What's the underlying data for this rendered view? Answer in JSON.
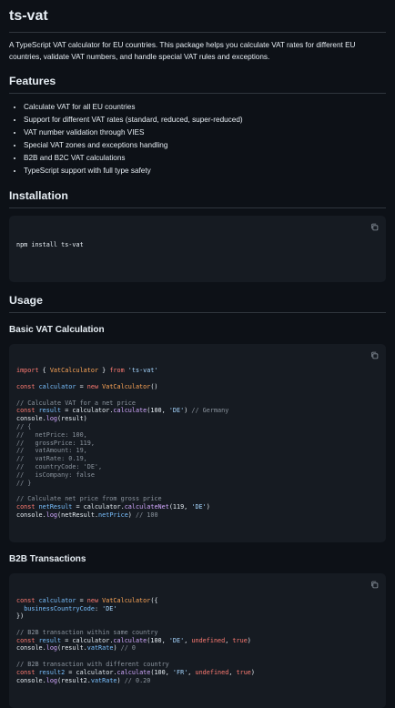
{
  "title": "ts-vat",
  "intro": "A TypeScript VAT calculator for EU countries. This package helps you calculate VAT rates for different EU countries, validate VAT numbers, and handle special VAT rules and exceptions.",
  "features": {
    "heading": "Features",
    "items": [
      "Calculate VAT for all EU countries",
      "Support for different VAT rates (standard, reduced, super-reduced)",
      "VAT number validation through VIES",
      "Special VAT zones and exceptions handling",
      "B2B and B2C VAT calculations",
      "TypeScript support with full type safety"
    ]
  },
  "installation": {
    "heading": "Installation",
    "command": "npm install ts-vat"
  },
  "usage": {
    "heading": "Usage",
    "basic": {
      "heading": "Basic VAT Calculation",
      "lines": [
        "import { VatCalculator } from 'ts-vat'",
        "",
        "const calculator = new VatCalculator()",
        "",
        "// Calculate VAT for a net price",
        "const result = calculator.calculate(100, 'DE') // Germany",
        "console.log(result)",
        "// {",
        "//   netPrice: 100,",
        "//   grossPrice: 119,",
        "//   vatAmount: 19,",
        "//   vatRate: 0.19,",
        "//   countryCode: 'DE',",
        "//   isCompany: false",
        "// }",
        "",
        "// Calculate net price from gross price",
        "const netResult = calculator.calculateNet(119, 'DE')",
        "console.log(netResult.netPrice) // 100"
      ]
    },
    "b2b": {
      "heading": "B2B Transactions",
      "lines": [
        "const calculator = new VatCalculator({",
        "  businessCountryCode: 'DE'",
        "})",
        "",
        "// B2B transaction within same country",
        "const result = calculator.calculate(100, 'DE', undefined, true)",
        "console.log(result.vatRate) // 0",
        "",
        "// B2B transaction with different country",
        "const result2 = calculator.calculate(100, 'FR', undefined, true)",
        "console.log(result2.vatRate) // 0.20"
      ]
    }
  },
  "icons": {
    "copy": "copy-icon"
  },
  "colors": {
    "background": "#0d1117",
    "code_background": "#161b22",
    "keyword": "#ff7b72",
    "comment": "#8b949e",
    "string": "#a5d6ff",
    "class": "#ffa657",
    "function": "#d2a8ff",
    "property": "#79c0ff"
  }
}
